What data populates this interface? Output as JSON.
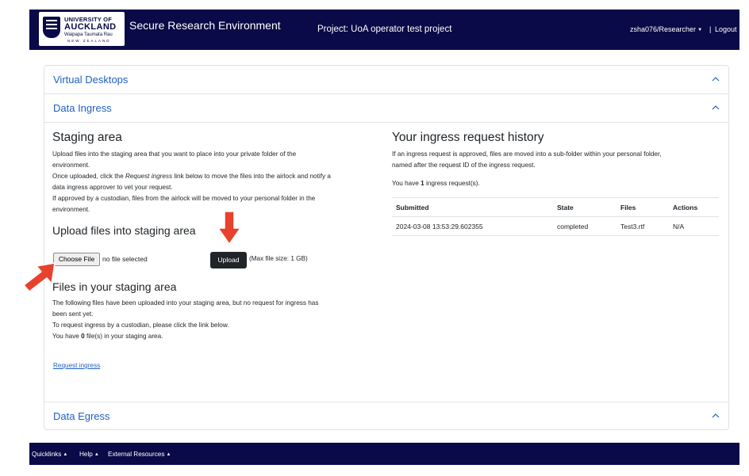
{
  "header": {
    "logo_line1": "UNIVERSITY OF",
    "logo_line2": "AUCKLAND",
    "logo_line3": "Waipapa Taumata Rau",
    "logo_line4": "NEW ZEALAND",
    "app_title": "Secure Research Environment",
    "project": "Project: UoA operator test project",
    "user": "zsha076/Researcher",
    "separator": "|",
    "logout": "Logout"
  },
  "accordion": {
    "virtual_desktops": "Virtual Desktops",
    "data_ingress": "Data Ingress",
    "data_egress": "Data Egress"
  },
  "staging": {
    "title": "Staging area",
    "p1": "Upload files into the staging area that you want to place into your private folder of the",
    "p1b": "environment.",
    "p2a": "Once uploaded, click the ",
    "p2_em": "Request ingress",
    "p2b": " link below to move the files into the airlock and notify a",
    "p2c": "data ingress approver to vet your request.",
    "p3": "If approved by a custodian, files from the airlock will be moved to your personal folder in the",
    "p3b": "environment."
  },
  "upload": {
    "title": "Upload files into staging area",
    "choose_file": "Choose File",
    "no_file": "no file selected",
    "upload_button": "Upload",
    "max_size": "(Max file size: 1 GB)"
  },
  "files": {
    "title": "Files in your staging area",
    "p1": "The following files have been uploaded into your staging area, but no request for ingress has",
    "p1b": "been sent yet.",
    "p2": "To request ingress by a custodian, please click the link below.",
    "p3a": "You have ",
    "p3_count": "0",
    "p3b": " file(s) in your staging area.",
    "request_link": "Request ingress"
  },
  "history": {
    "title": "Your ingress request history",
    "p1": "If an ingress request is approved, files are moved into a sub-folder within your personal folder,",
    "p1b": "named after the request ID of the ingress request.",
    "count_a": "You have ",
    "count": "1",
    "count_b": " ingress request(s).",
    "columns": [
      "Submitted",
      "State",
      "Files",
      "Actions"
    ],
    "rows": [
      [
        "2024-03-08 13:53:29.602355",
        "completed",
        "Test3.rtf",
        "N/A"
      ]
    ]
  },
  "footer": {
    "quicklinks": "Quicklinks",
    "help": "Help",
    "external": "External Resources"
  },
  "colors": {
    "navy": "#0a0a48",
    "link_blue": "#1f5fc2",
    "arrow_red": "#e8412c"
  },
  "icons": {
    "chevron": "chevron-up-icon",
    "caret": "caret-down-icon",
    "arrow": "red-arrow-annotation"
  }
}
